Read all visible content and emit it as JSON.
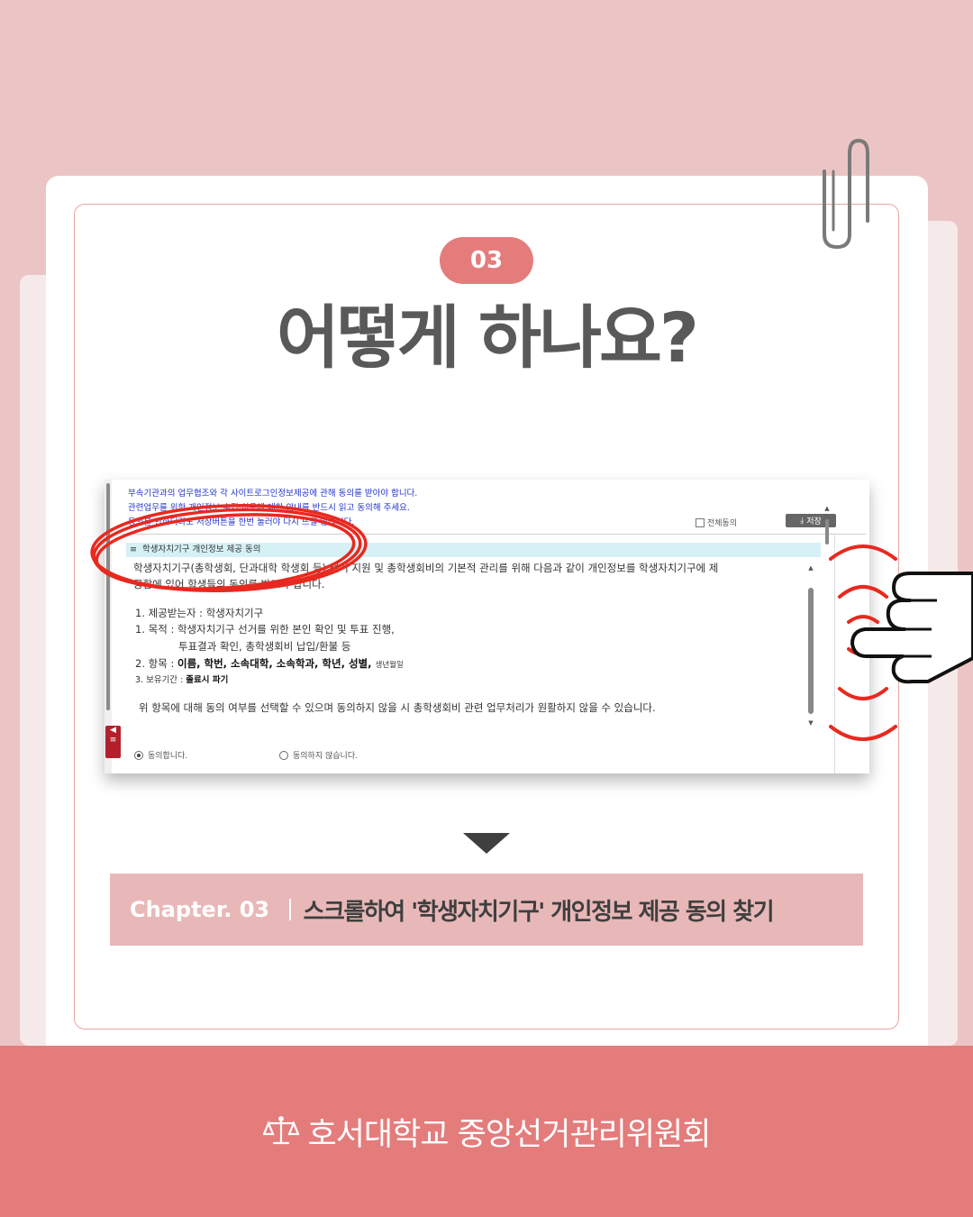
{
  "step": {
    "number": "03",
    "title": "어떻게 하나요?"
  },
  "screenshot": {
    "notices": [
      "부속기관과의 업무협조와 각 사이트로그인정보제공에 관해 동의를 받아야 합니다.",
      "관련업무를 위한 개인정보 수집·이용에 대한 안내를 반드시 읽고 동의해 주세요.",
      "동의를 안하더라도 저장버튼을 한번 눌러야 다시 뜨질 않습니다."
    ],
    "agree_all_label": "전체동의",
    "save_label": "저장",
    "section_title": "학생자치기구 개인정보 제공 동의",
    "intro_line1": "학생자치기구(총학생회, 단과대학 학생회 등) 선거 지원 및 총학생회비의 기본적 관리를 위해 다음과 같이 개인정보를 학생자치기구에 제",
    "intro_line2": "공함에 있어 학생들의 동의를 받고자 합니다.",
    "recipient": "1. 제공받는자 : 학생자치기구",
    "purpose_line1": "1. 목적 : 학생자치기구 선거를 위한 본인 확인 및 투표 진행,",
    "purpose_line2": "투표결과 확인, 총학생회비 납입/환불 등",
    "items_prefix": "2. 항목 : ",
    "items_bold": "이름, 학번, 소속대학, 소속학과, 학년, 성별, ",
    "items_small": "생년월일",
    "retention_prefix": "3. 보유기간 : ",
    "retention_bold": "졸료시 파기",
    "notice_text": "위 항목에 대해 동의 여부를 선택할 수 있으며 동의하지 않을 시 총학생회비 관련 업무처리가 원활하지 않을 수 있습니다.",
    "agree_option": "동의합니다.",
    "disagree_option": "동의하지 않습니다.",
    "selected_option": "agree"
  },
  "chapter": {
    "label": "Chapter. 03",
    "text": "스크롤하여 '학생자치기구' 개인정보 제공 동의 찾기"
  },
  "footer": {
    "org_name": "호서대학교 중앙선거관리위원회"
  },
  "colors": {
    "accent": "#e47c7c",
    "background": "#ebc5c5",
    "chapter_bar": "#e8b8b8",
    "highlight": "#e8291f"
  },
  "icons": [
    "paperclip-icon",
    "down-arrow-icon",
    "scale-icon",
    "hand-pointer-icon",
    "download-icon"
  ]
}
